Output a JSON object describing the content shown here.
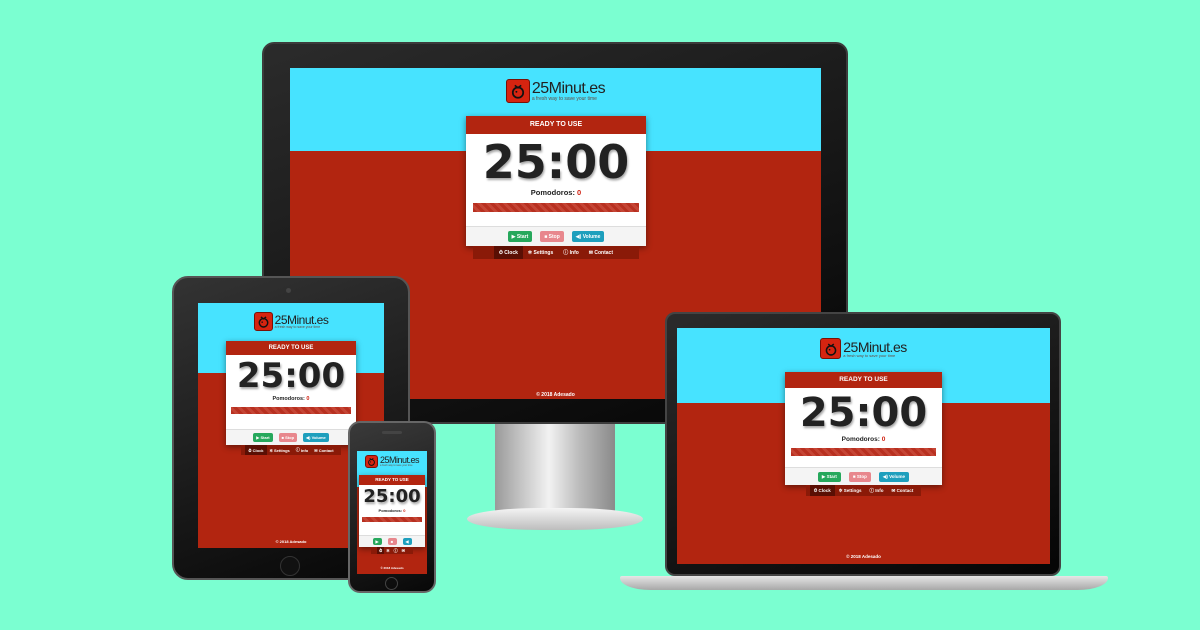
{
  "app": {
    "brand": "25Minut.es",
    "tagline": "a fresh way to save your time",
    "status": "READY TO USE",
    "time": "25:00",
    "pomodoros_label": "Pomodoros:",
    "pomodoros_count": "0",
    "progress": 1.0,
    "buttons": {
      "start": "Start",
      "stop": "Stop",
      "volume": "Volume"
    },
    "icons": {
      "start": "play-icon",
      "stop": "stop-icon",
      "volume": "volume-icon",
      "clock": "clock-icon",
      "settings": "gear-icon",
      "info": "info-icon",
      "contact": "envelope-icon"
    },
    "tabs": [
      {
        "label": "Clock"
      },
      {
        "label": "Settings"
      },
      {
        "label": "Info"
      },
      {
        "label": "Contact"
      }
    ],
    "footer": "© 2018 Adesado"
  },
  "colors": {
    "background": "#7bffd1",
    "sky": "#47e3ff",
    "brand_red": "#b22510",
    "start": "#26a85c",
    "stop": "#e8878d",
    "volume": "#1e9fbd"
  }
}
